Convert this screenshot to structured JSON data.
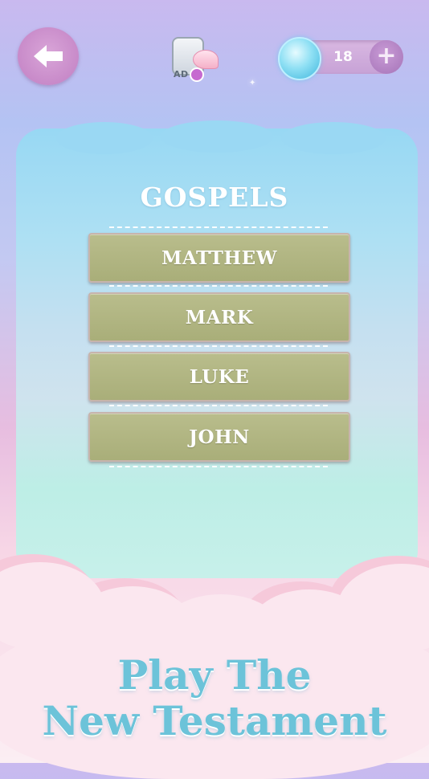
{
  "header": {
    "back_icon": "arrow-left-icon",
    "ad_badge": {
      "label": "AD",
      "icon": "video-ad-icon"
    },
    "gems": {
      "count": "18",
      "icon": "gem-icon",
      "plus_icon": "plus-icon"
    }
  },
  "panel": {
    "title": "GOSPELS",
    "books": [
      {
        "label": "MATTHEW"
      },
      {
        "label": "MARK"
      },
      {
        "label": "LUKE"
      },
      {
        "label": "JOHN"
      }
    ]
  },
  "tagline": {
    "line1": "Play The",
    "line2": "New Testament"
  },
  "colors": {
    "button_fill": "#aeb27d",
    "tagline": "#6cc3d9",
    "accent_purple": "#c88ac9"
  }
}
